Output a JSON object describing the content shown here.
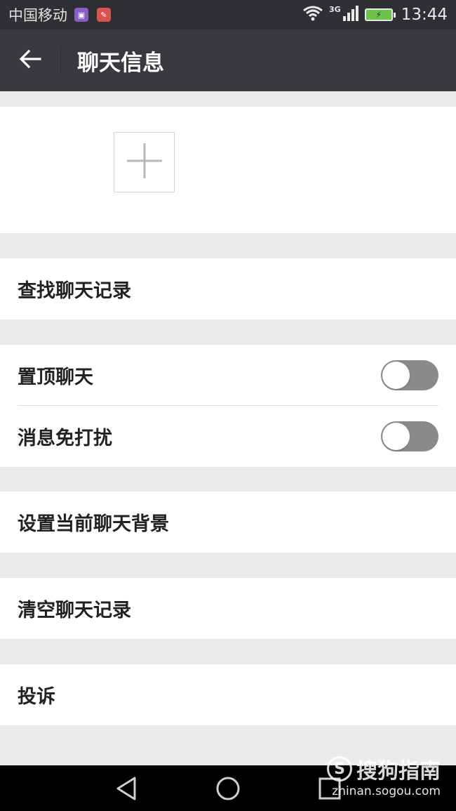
{
  "status_bar": {
    "carrier": "中国移动",
    "network_type": "3G",
    "time": "13:44",
    "battery_color": "#6cc24a",
    "icons": [
      "gallery-notification-icon",
      "app-notification-icon",
      "wifi-icon",
      "signal-icon",
      "battery-charging-icon"
    ]
  },
  "app_bar": {
    "back_icon": "arrow-left-icon",
    "title": "聊天信息"
  },
  "members": {
    "add_icon": "plus-icon"
  },
  "settings": {
    "search_history": "查找聊天记录",
    "pin_chat": {
      "label": "置顶聊天",
      "enabled": false
    },
    "mute": {
      "label": "消息免打扰",
      "enabled": false
    },
    "set_background": "设置当前聊天背景",
    "clear_history": "清空聊天记录",
    "report": "投诉"
  },
  "nav_bar": {
    "icons": [
      "back-triangle-icon",
      "home-circle-icon",
      "recents-square-icon"
    ]
  },
  "watermark": {
    "brand": "搜狗指南",
    "url": "zhinan.sogou.com"
  },
  "colors": {
    "status_bar": "#2f3033",
    "app_bar": "#393a3f",
    "background": "#ebebeb",
    "toggle_off": "#8a8a8a"
  }
}
